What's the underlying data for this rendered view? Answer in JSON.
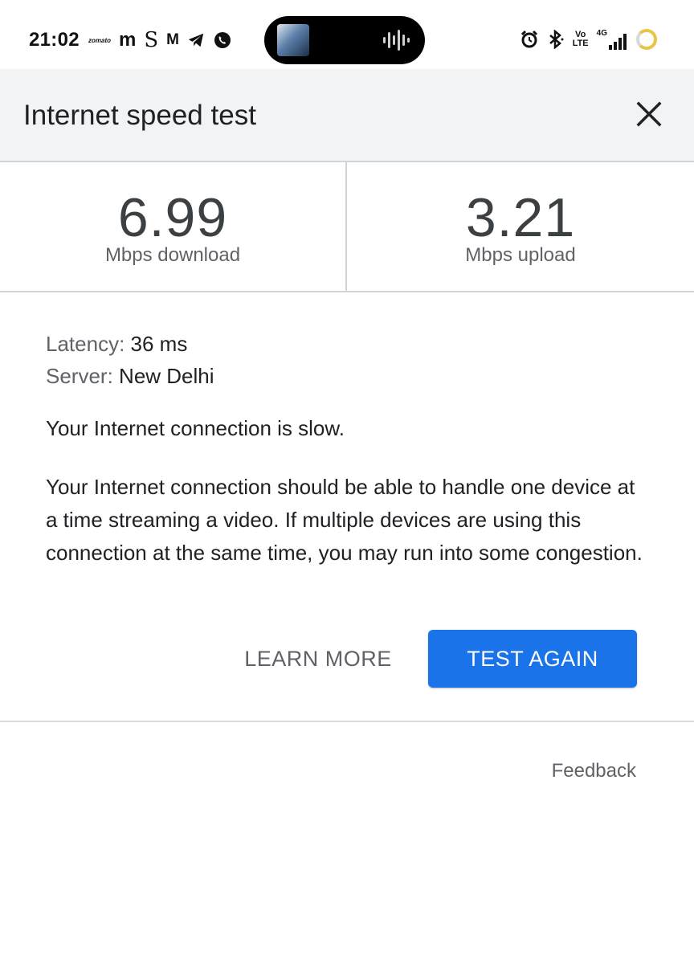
{
  "status_bar": {
    "time": "21:02",
    "left_icons": [
      "zomato-icon",
      "m-app-icon",
      "s-app-icon",
      "m-app-icon",
      "telegram-icon",
      "whatsapp-icon"
    ],
    "zomato_text": "zomato",
    "glyph_m": "m",
    "glyph_s": "S",
    "glyph_m2": "M",
    "island_icons": [
      "album-art-icon",
      "waveform-icon"
    ],
    "right_icons": [
      "alarm-icon",
      "bluetooth-icon",
      "volte-icon",
      "signal-4g-icon",
      "battery-icon"
    ],
    "volte_top": "Vo",
    "volte_bottom": "LTE",
    "network": "4G"
  },
  "header": {
    "title": "Internet speed test",
    "close_icon": "close-icon"
  },
  "results": {
    "download": {
      "value": "6.99",
      "unit": "Mbps download"
    },
    "upload": {
      "value": "3.21",
      "unit": "Mbps upload"
    }
  },
  "details": {
    "latency_label": "Latency:",
    "latency_value": "36 ms",
    "server_label": "Server:",
    "server_value": "New Delhi",
    "status": "Your Internet connection is slow.",
    "description": "Your Internet connection should be able to handle one device at a time streaming a video. If multiple devices are using this connection at the same time, you may run into some congestion."
  },
  "actions": {
    "learn_more": "LEARN MORE",
    "test_again": "TEST AGAIN"
  },
  "footer": {
    "feedback": "Feedback"
  },
  "colors": {
    "accent": "#1a73e8",
    "header_bg": "#f1f3f4",
    "battery": "#e8c547"
  }
}
